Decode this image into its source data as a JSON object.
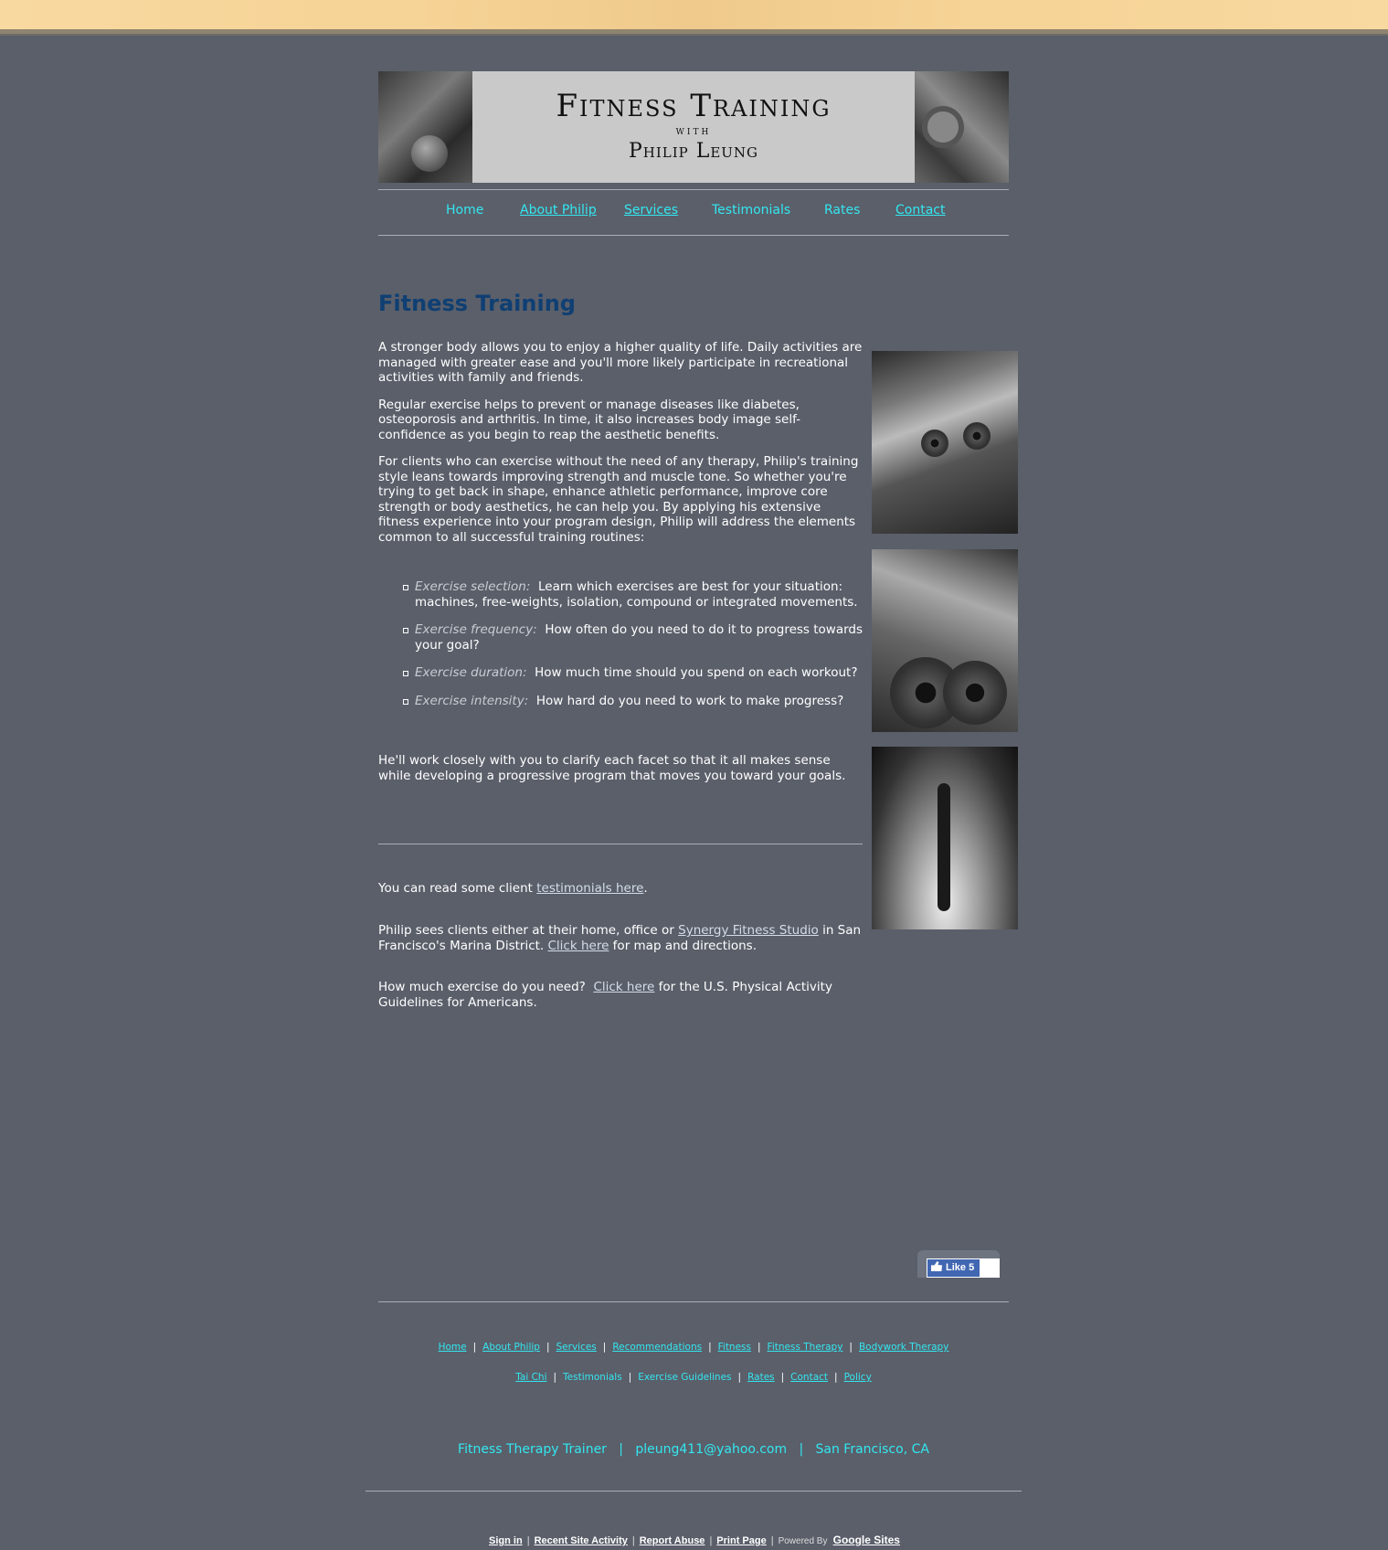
{
  "banner": {
    "title": "Fitness Training",
    "with": "with",
    "name": "Philip Leung"
  },
  "nav": [
    {
      "label": "Home"
    },
    {
      "label": "About Philip"
    },
    {
      "label": "Services"
    },
    {
      "label": "Testimonials"
    },
    {
      "label": "Rates"
    },
    {
      "label": "Contact"
    }
  ],
  "page": {
    "title": "Fitness Training",
    "paragraphs": [
      "A stronger body allows you to enjoy a higher quality of life.  Daily activities are managed with greater ease and you'll more likely participate in recreational activities with family and friends.",
      "Regular exercise helps to prevent or manage diseases like diabetes, osteoporosis and arthritis.  In time, it also increases body image self-confidence as you begin to reap the aesthetic benefits.",
      "For clients who can exercise without the need of any therapy, Philip's training style leans towards improving strength and muscle tone.  So whether you're trying to get back in shape, enhance athletic performance, improve core strength or body aesthetics, he can help you.  By applying his extensive fitness experience into your program design, Philip will address the elements common to all successful training routines:"
    ],
    "bullets": [
      {
        "term": "Exercise selection:",
        "text": "  Learn which exercises are best for your situation: machines, free-weights, isolation, compound or integrated movements."
      },
      {
        "term": "Exercise frequency:",
        "text": "  How often do you need to do it to progress towards your goal?"
      },
      {
        "term": "Exercise duration:",
        "text": "  How much time should you spend on each workout?"
      },
      {
        "term": "Exercise intensity:",
        "text": "  How hard do you need to work to make progress?"
      }
    ],
    "closing": "He'll work closely with you to clarify each facet so that it all makes sense while developing a progressive program that moves you toward your goals.",
    "testimonials_pre": "You can read some client ",
    "testimonials_link": "testimonials here",
    "testimonials_post": ".",
    "location_pre": "Philip sees clients either at their home, office or ",
    "location_link": "Synergy Fitness Studio",
    "location_mid": " in San Francisco's Marina District. ",
    "location_link2": "Click here",
    "location_post": " for map and directions.",
    "exercise_pre": "How much exercise do you need?  ",
    "exercise_link": "Click here",
    "exercise_post": " for the U.S. Physical Activity Guidelines for Americans."
  },
  "like": {
    "label": "Like 5"
  },
  "footer_nav": {
    "row1": [
      "Home",
      "About Philip",
      "Services",
      "Recommendations",
      "Fitness",
      "Fitness Therapy",
      "Bodywork Therapy"
    ],
    "row2": [
      "Tai Chi",
      "Testimonials",
      "Exercise Guidelines",
      "Rates",
      "Contact",
      "Policy"
    ]
  },
  "contact": {
    "role": "Fitness Therapy Trainer",
    "email": "pleung411@yahoo.com",
    "city": "San Francisco, CA"
  },
  "sites_footer": {
    "sign_in": "Sign in",
    "recent": "Recent Site Activity",
    "report": "Report Abuse",
    "print": "Print Page",
    "powered": "Powered By",
    "google": "Google Sites"
  },
  "colors": {
    "background": "#5a5f6a",
    "link_cyan": "#33e7f0",
    "heading_blue": "#0f3f73"
  }
}
